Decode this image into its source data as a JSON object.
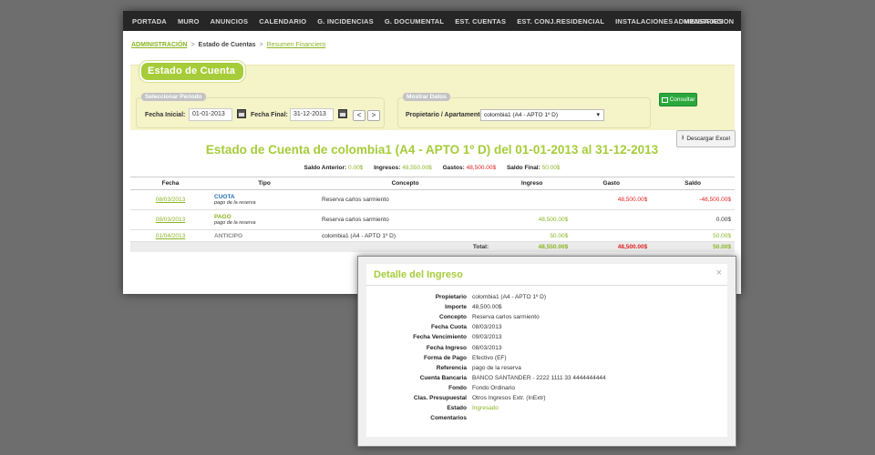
{
  "nav": {
    "items": [
      "PORTADA",
      "MURO",
      "ANUNCIOS",
      "CALENDARIO",
      "G. INCIDENCIAS",
      "G. DOCUMENTAL",
      "EST. CUENTAS",
      "EST. CONJ.RESIDENCIAL",
      "INSTALACIONES",
      "MENSAJES"
    ],
    "right": "ADMINISTRACION"
  },
  "breadcrumb": {
    "item1": "ADMINISTRACIÓN",
    "item2": "Estado de Cuentas",
    "item3": "Resumen Financiero",
    "sep": ">"
  },
  "panel": {
    "title": "Estado de Cuenta",
    "period_legend": "Seleccionar Periodo",
    "fecha_inicial_label": "Fecha Inicial:",
    "fecha_inicial_value": "01-01-2013",
    "fecha_final_label": "Fecha Final:",
    "fecha_final_value": "31-12-2013",
    "data_legend": "Mostrar Datos",
    "propietario_label": "Propietario / Apartamento",
    "propietario_value": "colombia1 (A4 - APTO 1º D)",
    "consultar_label": "Consultar",
    "prev_label": "<",
    "next_label": ">"
  },
  "download_label": "Descargar Excel",
  "page_title": "Estado de Cuenta de colombia1 (A4 - APTO 1º D) del 01-01-2013 al 31-12-2013",
  "summary": {
    "saldo_anterior_label": "Saldo Anterior:",
    "saldo_anterior_value": "0.00$",
    "ingresos_label": "Ingresos:",
    "ingresos_value": "48,550.00$",
    "gastos_label": "Gastos:",
    "gastos_value": "48,500.00$",
    "saldo_final_label": "Saldo Final:",
    "saldo_final_value": "50.00$"
  },
  "table": {
    "headers": [
      "Fecha",
      "Tipo",
      "Concepto",
      "Ingreso",
      "Gasto",
      "Saldo"
    ],
    "rows": [
      {
        "fecha": "08/03/2013",
        "tipo": "CUOTA",
        "tipo_sub": "pago de la reserva",
        "concepto": "Reserva carlos sarmiento",
        "ingreso": "",
        "gasto": "48,500.00$",
        "saldo": "-48,500.00$"
      },
      {
        "fecha": "08/03/2013",
        "tipo": "PAGO",
        "tipo_sub": "pago de la reserva",
        "concepto": "Reserva carlos sarmiento",
        "ingreso": "48,500.00$",
        "gasto": "",
        "saldo": "0.00$"
      },
      {
        "fecha": "01/04/2013",
        "tipo": "ANTICIPO",
        "tipo_sub": "",
        "concepto": "colombia1 (A4 - APTO 1º D)",
        "ingreso": "50.00$",
        "gasto": "",
        "saldo": "50.00$"
      }
    ],
    "total_label": "Total:",
    "total_ingreso": "48,550.00$",
    "total_gasto": "48,500.00$",
    "total_saldo": "50.00$"
  },
  "modal": {
    "title": "Detalle del Ingreso",
    "close": "×",
    "rows": [
      {
        "k": "Propietario",
        "v": "colombia1 (A4 - APTO 1º D)"
      },
      {
        "k": "Importe",
        "v": "48,500.00$"
      },
      {
        "k": "Concepto",
        "v": "Reserva carlos sarmiento"
      },
      {
        "k": "Fecha Cuota",
        "v": "08/03/2013"
      },
      {
        "k": "Fecha Vencimiento",
        "v": "09/03/2013"
      },
      {
        "k": "Fecha Ingreso",
        "v": "08/03/2013"
      },
      {
        "k": "Forma de Pago",
        "v": "Efectivo (EF)"
      },
      {
        "k": "Referencia",
        "v": "pago de la reserva"
      },
      {
        "k": "Cuenta Bancaria",
        "v": "BANCO SANTANDER - 2222 1111 33 4444444444"
      },
      {
        "k": "Fondo",
        "v": "Fondo Ordinario"
      },
      {
        "k": "Clas. Presupuestal",
        "v": "Otros Ingresos Extr. (InExtr)"
      },
      {
        "k": "Estado",
        "v": "Ingresado"
      },
      {
        "k": "Comentarios",
        "v": ""
      }
    ]
  },
  "colors": {
    "accent": "#a6cc39",
    "negative": "#dd2222",
    "nav_bg": "#262626",
    "panel_bg": "#f5f3c8",
    "button": "#2aa83c"
  }
}
